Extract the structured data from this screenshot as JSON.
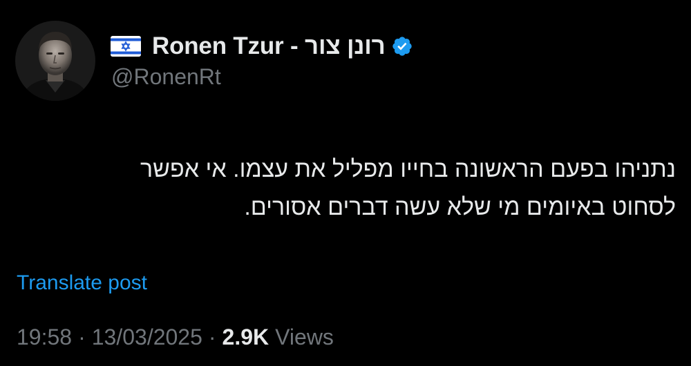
{
  "author": {
    "display_name": "Ronen Tzur - רונן צור",
    "handle": "@RonenRt",
    "flag_icon": "israel-flag-icon",
    "verified_icon": "verified-badge-icon",
    "verified_color": "#1d9bf0"
  },
  "tweet": {
    "lines": [
      "נתניהו בפעם הראשונה בחייו מפליל את עצמו. אי אפשר",
      "לסחוט באיומים מי שלא עשה דברים אסורים."
    ]
  },
  "translate_label": "Translate post",
  "meta": {
    "time": "19:58",
    "separator": "·",
    "date": "13/03/2025",
    "views_count": "2.9K",
    "views_label": "Views"
  },
  "colors": {
    "background": "#000000",
    "text_primary": "#e7e9ea",
    "text_secondary": "#71767b",
    "link": "#1d9bf0"
  }
}
